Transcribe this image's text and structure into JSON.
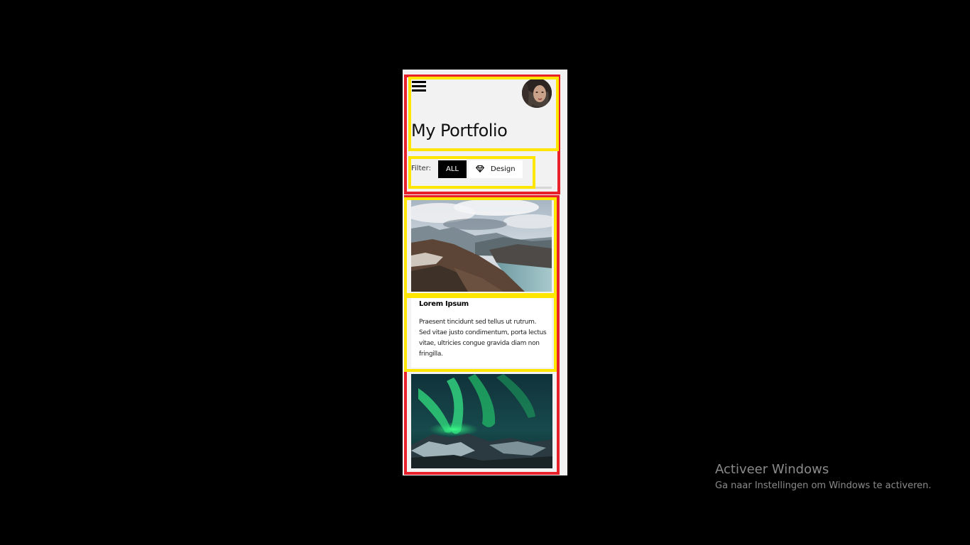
{
  "header": {
    "menu_icon": "hamburger-menu-icon",
    "avatar": "profile-avatar",
    "title": "My Portfolio"
  },
  "filter": {
    "label": "Filter:",
    "options": [
      {
        "label": "ALL",
        "active": true
      },
      {
        "label": "Design",
        "icon": "gem-icon",
        "active": false
      }
    ]
  },
  "cards": [
    {
      "image": "mountain-lake-photo",
      "title": "Lorem Ipsum",
      "text": "Praesent tincidunt sed tellus ut rutrum. Sed vitae justo condimentum, porta lectus vitae, ultricies congue gravida diam non fringilla."
    },
    {
      "image": "northern-lights-photo"
    }
  ],
  "watermark": {
    "title": "Activeer Windows",
    "subtitle": "Ga naar Instellingen om Windows te activeren."
  },
  "colors": {
    "outline_red": "#e8202a",
    "outline_yellow": "#ffe600",
    "background": "#000000",
    "page_bg": "#f2f2f2",
    "active_filter": "#000000"
  }
}
